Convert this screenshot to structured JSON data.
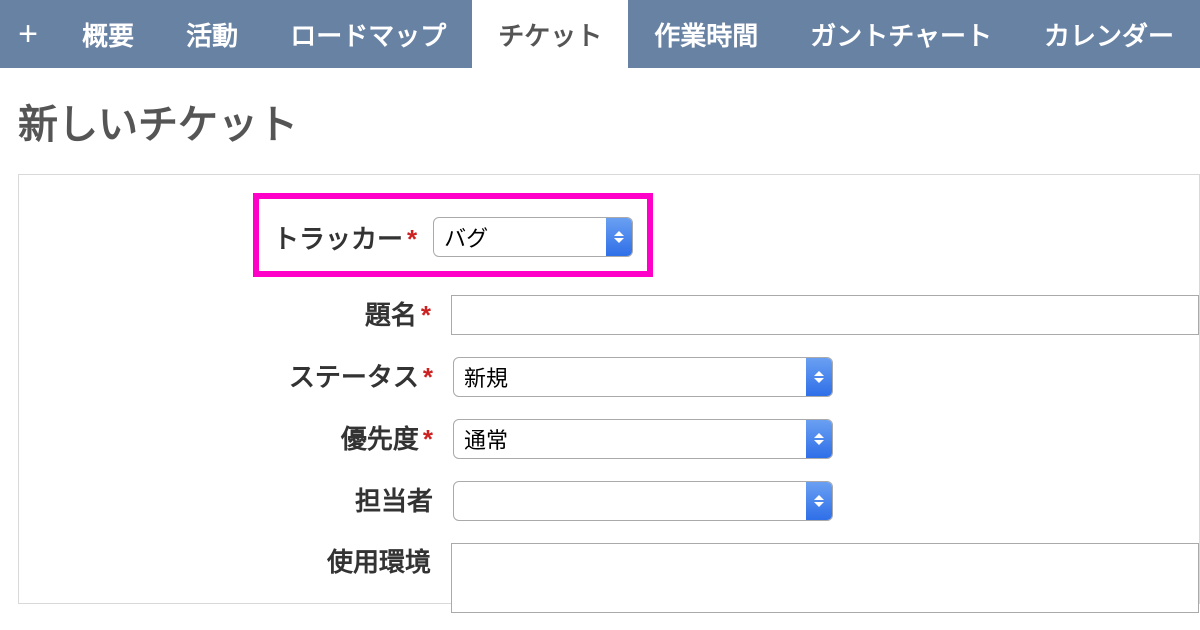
{
  "tabs": {
    "add": "+",
    "items": [
      {
        "label": "概要"
      },
      {
        "label": "活動"
      },
      {
        "label": "ロードマップ"
      },
      {
        "label": "チケット",
        "active": true
      },
      {
        "label": "作業時間"
      },
      {
        "label": "ガントチャート"
      },
      {
        "label": "カレンダー"
      }
    ]
  },
  "page_title": "新しいチケット",
  "form": {
    "tracker": {
      "label": "トラッカー",
      "value": "バグ",
      "required": "*"
    },
    "subject": {
      "label": "題名",
      "value": "",
      "required": "*"
    },
    "status": {
      "label": "ステータス",
      "value": "新規",
      "required": "*"
    },
    "priority": {
      "label": "優先度",
      "value": "通常",
      "required": "*"
    },
    "assignee": {
      "label": "担当者",
      "value": ""
    },
    "env": {
      "label": "使用環境",
      "value": ""
    }
  },
  "colors": {
    "tab_bg": "#6882a4",
    "highlight_border": "#ff00c8",
    "required": "#c22"
  }
}
